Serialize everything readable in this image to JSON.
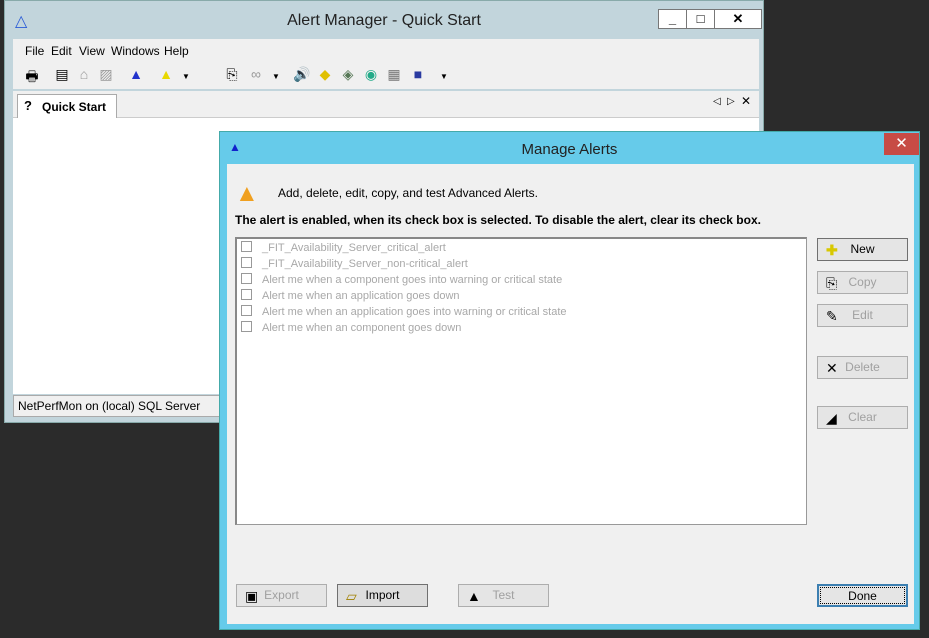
{
  "main_window": {
    "title": "Alert Manager - Quick Start",
    "menu": [
      "File",
      "Edit",
      "View",
      "Windows",
      "Help"
    ],
    "tab": "Quick Start",
    "status": "NetPerfMon on (local) SQL Server"
  },
  "dialog": {
    "title": "Manage Alerts",
    "description": "Add, delete, edit, copy, and test Advanced Alerts.",
    "instruction": "The alert is enabled, when its check box is selected. To disable the alert, clear its check box.",
    "alerts": [
      "_FIT_Availability_Server_critical_alert",
      "_FIT_Availability_Server_non-critical_alert",
      "Alert me when a component goes into warning or critical state",
      "Alert me when an application goes down",
      "Alert me when an application goes into warning or critical state",
      "Alert me when an component goes down"
    ],
    "buttons": {
      "new": "New",
      "copy": "Copy",
      "edit": "Edit",
      "delete": "Delete",
      "clear": "Clear",
      "export": "Export",
      "import": "Import",
      "test": "Test",
      "done": "Done"
    }
  }
}
